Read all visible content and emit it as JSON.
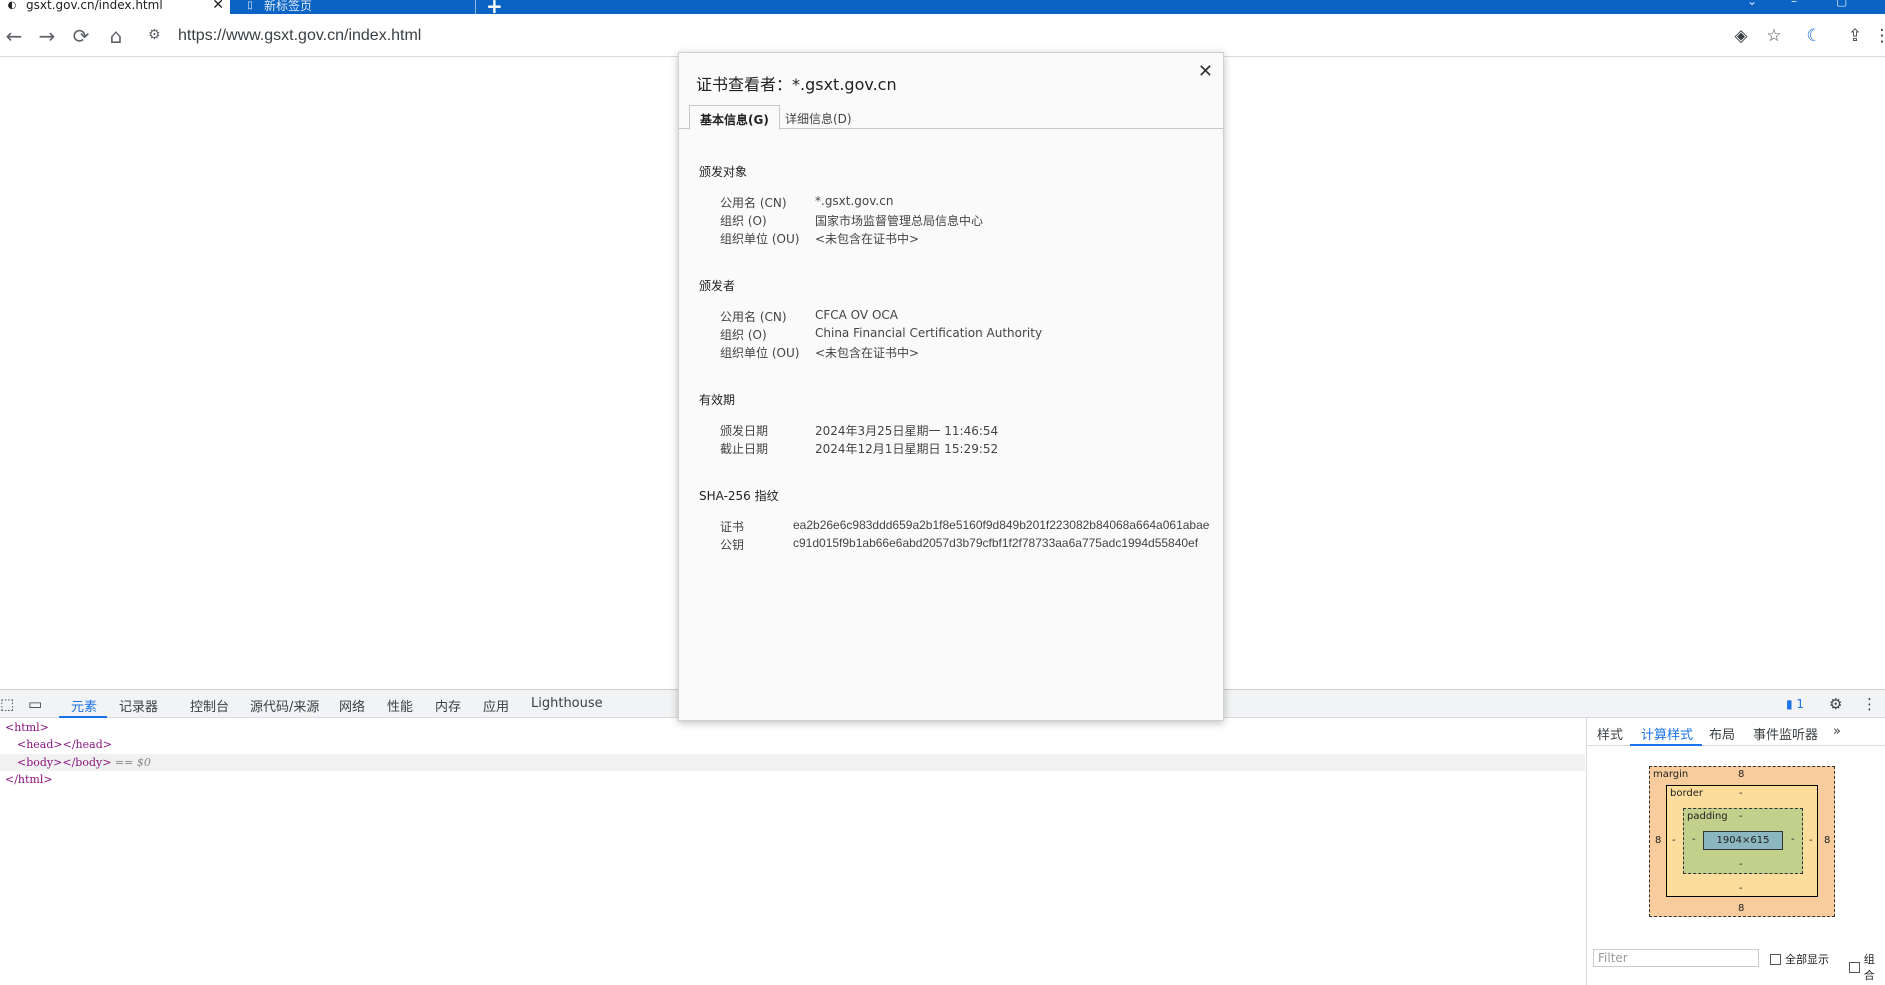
{
  "browser": {
    "tabs": [
      {
        "title": "gsxt.gov.cn/index.html",
        "active": true
      },
      {
        "title": "新标签页",
        "active": false
      }
    ],
    "url": "https://www.gsxt.gov.cn/index.html"
  },
  "cert_dialog": {
    "title": "证书查看者：*.gsxt.gov.cn",
    "tabs": [
      "基本信息(G)",
      "详细信息(D)"
    ],
    "issued_to": {
      "heading": "颁发对象",
      "rows": [
        {
          "k": "公用名 (CN)",
          "v": "*.gsxt.gov.cn"
        },
        {
          "k": "组织 (O)",
          "v": "国家市场监督管理总局信息中心"
        },
        {
          "k": "组织单位 (OU)",
          "v": "<未包含在证书中>"
        }
      ]
    },
    "issued_by": {
      "heading": "颁发者",
      "rows": [
        {
          "k": "公用名 (CN)",
          "v": "CFCA OV OCA"
        },
        {
          "k": "组织 (O)",
          "v": "China Financial Certification Authority"
        },
        {
          "k": "组织单位 (OU)",
          "v": "<未包含在证书中>"
        }
      ]
    },
    "validity": {
      "heading": "有效期",
      "rows": [
        {
          "k": "颁发日期",
          "v": "2024年3月25日星期一 11:46:54"
        },
        {
          "k": "截止日期",
          "v": "2024年12月1日星期日 15:29:52"
        }
      ]
    },
    "fingerprints": {
      "heading": "SHA-256 指纹",
      "rows": [
        {
          "k": "证书",
          "v": "ea2b26e6c983ddd659a2b1f8e5160f9d849b201f223082b84068a664a061abae"
        },
        {
          "k": "公钥",
          "v": "c91d015f9b1ab66e6abd2057d3b79cfbf1f2f78733aa6a775adc1994d55840ef"
        }
      ]
    }
  },
  "devtools": {
    "tabs": [
      "元素",
      "记录器",
      "控制台",
      "源代码/来源",
      "网络",
      "性能",
      "内存",
      "应用",
      "Lighthouse"
    ],
    "issues_count": "1",
    "dom": [
      "<html>",
      "<head></head>",
      "<body></body>",
      "== $0",
      "</html>"
    ],
    "side_tabs": [
      "样式",
      "计算样式",
      "布局",
      "事件监听器"
    ],
    "box_model": {
      "margin_label": "margin",
      "margin_top": "8",
      "margin_bottom": "8",
      "margin_left": "8",
      "margin_right": "8",
      "border_label": "border",
      "border_top": "-",
      "border_bottom": "-",
      "border_left": "-",
      "border_right": "-",
      "padding_label": "padding",
      "padding_top": "-",
      "padding_bottom": "-",
      "padding_left": "-",
      "padding_right": "-",
      "content": "1904×615"
    },
    "filter_placeholder": "Filter",
    "show_all": "全部显示",
    "group": "组合"
  }
}
